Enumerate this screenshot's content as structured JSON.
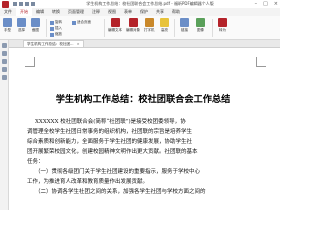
{
  "window": {
    "title": "学生机构工作总结：校社团联合会工作总结.pdf - 福昕PDF编辑器个人版",
    "controls": [
      "–",
      "□",
      "×"
    ]
  },
  "ribbon_tabs": [
    "文件",
    "开始",
    "编辑",
    "转换",
    "页面管理",
    "注释",
    "视图",
    "表单",
    "保护",
    "共享",
    "帮助"
  ],
  "ribbon": {
    "groups": [
      {
        "label": "手型",
        "icon": "hand-icon",
        "color": "#6b8ec7"
      },
      {
        "label": "选择",
        "icon": "select-icon",
        "color": "#6b8ec7"
      },
      {
        "label": "截图",
        "icon": "screenshot-icon",
        "color": "#6b8ec7"
      },
      {
        "label": "编辑文本",
        "icon": "edit-text-icon",
        "color": "#b4232a"
      },
      {
        "label": "编辑对象",
        "icon": "edit-object-icon",
        "color": "#b4232a"
      },
      {
        "label": "打字机",
        "icon": "typewriter-icon",
        "color": "#c9882a"
      },
      {
        "label": "高亮",
        "icon": "highlight-icon",
        "color": "#e8c33a"
      },
      {
        "label": "链接",
        "icon": "link-icon",
        "color": "#6b8ec7"
      },
      {
        "label": "图像",
        "icon": "image-icon",
        "color": "#5aa05a"
      },
      {
        "label": "转为",
        "icon": "convert-icon",
        "color": "#b4232a"
      }
    ],
    "mini": [
      "旋转",
      "插入",
      "缩放",
      "适合页面"
    ]
  },
  "doc_tab": {
    "label": "学生机构工作总结：校社团...",
    "close": "×"
  },
  "document": {
    "title": "学生机构工作总结：校社团联合会工作总结",
    "lines": [
      "XXXXXX 校社团联合会(简称“社团联”)是接受校团委领导，协",
      "调管理全校学生社团日常事务的组织机构，社团联的宗旨是培养学生",
      "综合素质和创新能力，全面服务于学生社团的健康发展，协助学生社",
      "团开展繁荣校园文化，创建校园精神文明作出更大贡献。社团联的基本",
      "任务：",
      "（一）贯彻各级团门关于学生社团建设的重要指示，服务于学校中心",
      "工作，为推进育人改革和教育质量作出发展贡献。",
      "（二）协调各学生社团之间的关系，加强各学生社团与学校方面之间的"
    ]
  }
}
